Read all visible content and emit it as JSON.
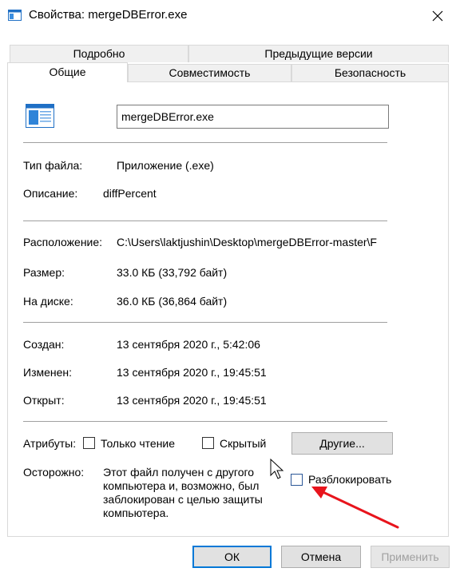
{
  "window": {
    "title": "Свойства: mergeDBError.exe",
    "icon": "exe-window-icon",
    "close_icon": "close-icon"
  },
  "tabs": {
    "row1": [
      "Подробно",
      "Предыдущие версии"
    ],
    "row2": [
      "Общие",
      "Совместимость",
      "Безопасность"
    ],
    "active": "Общие"
  },
  "general": {
    "file_name": "mergeDBError.exe",
    "file_type": {
      "label": "Тип файла:",
      "value": "Приложение (.exe)"
    },
    "description": {
      "label": "Описание:",
      "value": "diffPercent"
    },
    "location": {
      "label": "Расположение:",
      "value": "C:\\Users\\laktjushin\\Desktop\\mergeDBError-master\\F"
    },
    "size": {
      "label": "Размер:",
      "value": "33.0 КБ (33,792 байт)"
    },
    "size_on_disk": {
      "label": "На диске:",
      "value": "36.0 КБ (36,864 байт)"
    },
    "created": {
      "label": "Создан:",
      "value": "13 сентября 2020 г., 5:42:06"
    },
    "modified": {
      "label": "Изменен:",
      "value": "13 сентября 2020 г., 19:45:51"
    },
    "accessed": {
      "label": "Открыт:",
      "value": "13 сентября 2020 г., 19:45:51"
    },
    "attributes": {
      "label": "Атрибуты:",
      "readonly": {
        "label": "Только чтение",
        "checked": false
      },
      "hidden": {
        "label": "Скрытый",
        "checked": false
      },
      "other_button": "Другие..."
    },
    "security": {
      "label": "Осторожно:",
      "text": "Этот файл получен с другого компьютера и, возможно, был заблокирован с целью защиты компьютера.",
      "unblock": {
        "label": "Разблокировать",
        "checked": false
      }
    }
  },
  "footer": {
    "ok": "ОК",
    "cancel": "Отмена",
    "apply": "Применить"
  },
  "colors": {
    "accent": "#0078d7",
    "arrow": "#e8141c",
    "disabled_text": "#a0a0a0"
  }
}
